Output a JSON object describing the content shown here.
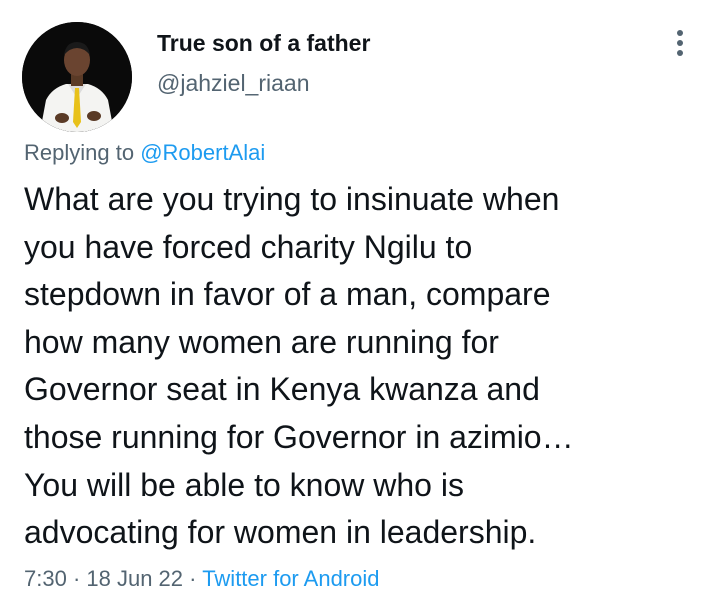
{
  "user": {
    "display_name": "True son of a father",
    "handle": "@jahziel_riaan"
  },
  "reply": {
    "prefix": "Replying to ",
    "mention": "@RobertAlai"
  },
  "tweet": {
    "lines": [
      "What are you trying to insinuate when",
      "you have forced charity Ngilu to",
      "stepdown in favor of a man, compare",
      "how many women are running for",
      "Governor seat in Kenya kwanza and",
      "those running for Governor in azimio…",
      "You will be able to know who is",
      "advocating for women in leadership."
    ]
  },
  "meta": {
    "time": "7:30",
    "separator": " · ",
    "date": "18 Jun 22",
    "source": "Twitter for Android"
  },
  "colors": {
    "text": "#0f1419",
    "secondary": "#536471",
    "link": "#1d9bf0"
  },
  "icons": {
    "more": "more-vertical-icon"
  }
}
